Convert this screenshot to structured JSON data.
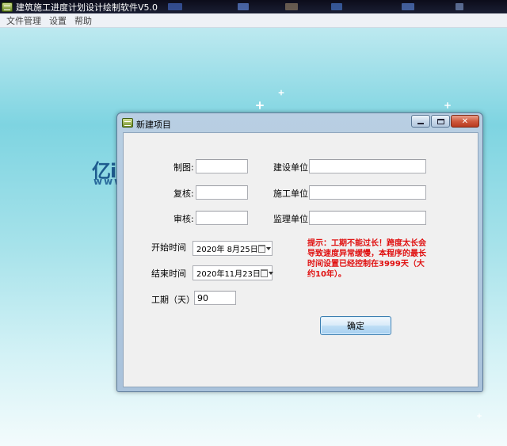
{
  "app": {
    "title": "建筑施工进度计划设计绘制软件V5.0"
  },
  "menu": {
    "items": [
      "文件管理",
      "设置",
      "帮助"
    ]
  },
  "desktop": {
    "logo_text": "亿i",
    "logo_sub": "www"
  },
  "dialog": {
    "title": "新建项目",
    "close_glyph": "✕",
    "fields": {
      "drafter_label": "制图:",
      "drafter_value": "",
      "reviewer_label": "复核:",
      "reviewer_value": "",
      "auditor_label": "审核:",
      "auditor_value": "",
      "construction_unit_label": "建设单位:",
      "construction_unit_value": "",
      "builder_unit_label": "施工单位:",
      "builder_unit_value": "",
      "supervisor_unit_label": "监理单位:",
      "supervisor_unit_value": ""
    },
    "start_time_label": "开始时间",
    "start_time_value": "2020年  8月25日",
    "end_time_label": "结束时间",
    "end_time_value": "2020年11月23日",
    "duration_label": "工期（天）",
    "duration_value": "90",
    "hint": "提示：工期不能过长！跨度太长会导致速度异常缓慢，本程序的最长时间设置已经控制在3999天（大约10年）。",
    "ok_label": "确定"
  },
  "colors": {
    "hint_text": "#e01010",
    "dialog_frame": "#b9cfe3",
    "close_button": "#cf5a3e"
  }
}
